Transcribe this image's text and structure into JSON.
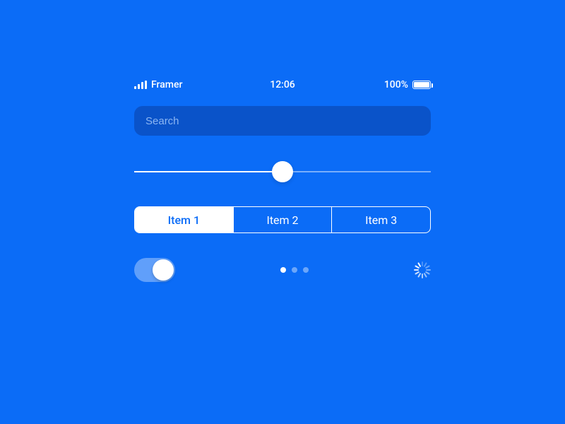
{
  "status_bar": {
    "carrier": "Framer",
    "time": "12:06",
    "battery_pct": "100%"
  },
  "search": {
    "placeholder": "Search",
    "value": ""
  },
  "slider": {
    "value": 50,
    "min": 0,
    "max": 100
  },
  "segmented": {
    "items": [
      "Item 1",
      "Item 2",
      "Item 3"
    ],
    "active_index": 0
  },
  "toggle": {
    "on": true
  },
  "page_dots": {
    "count": 3,
    "active_index": 0
  }
}
